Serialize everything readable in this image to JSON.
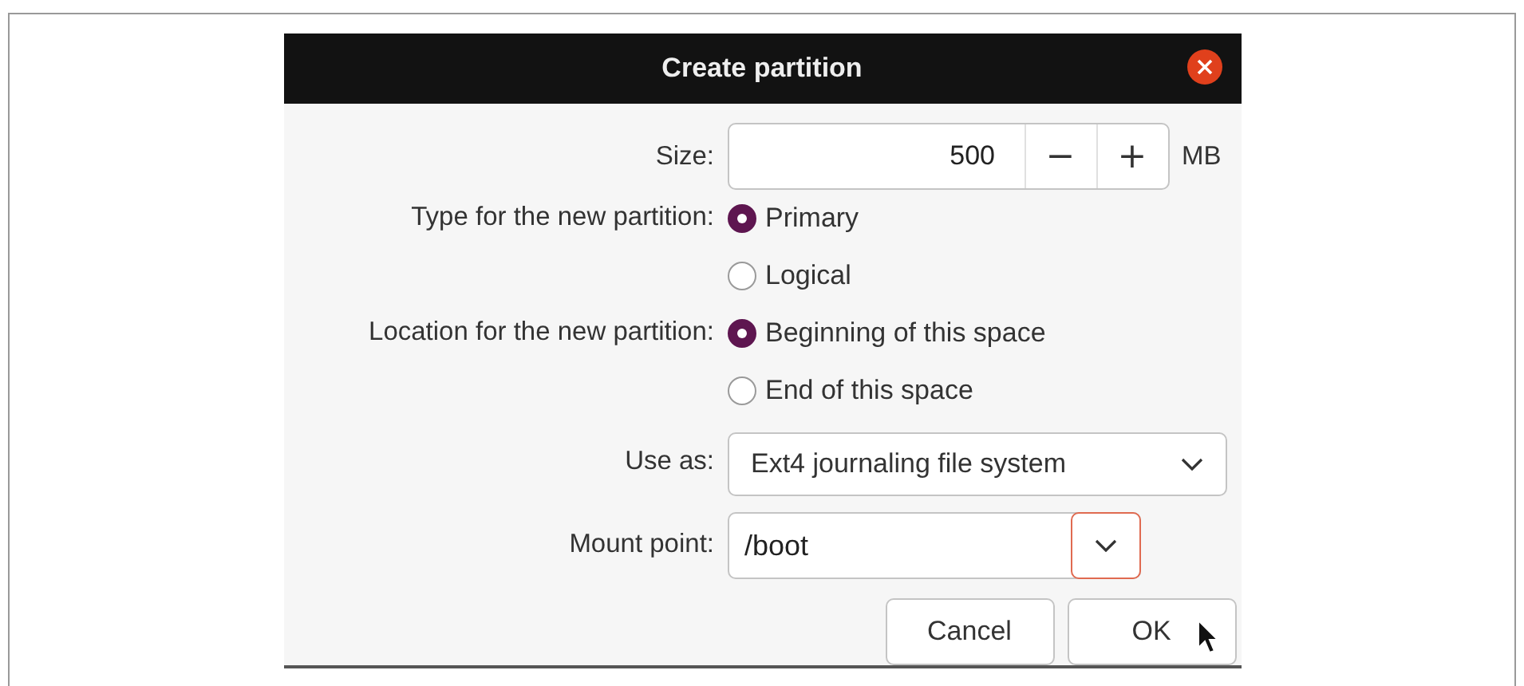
{
  "window": {
    "title": "Create partition"
  },
  "size": {
    "label": "Size:",
    "value": "500",
    "decrement": "−",
    "increment": "+",
    "unit": "MB"
  },
  "radio_groups": [
    {
      "label": "Type for the new partition:",
      "options": [
        {
          "label": "Primary",
          "selected": true
        },
        {
          "label": "Logical",
          "selected": false
        }
      ]
    },
    {
      "label": "Location for the new partition:",
      "options": [
        {
          "label": "Beginning of this space",
          "selected": true
        },
        {
          "label": "End of this space",
          "selected": false
        }
      ]
    }
  ],
  "use_as": {
    "label": "Use as:",
    "value": "Ext4 journaling file system"
  },
  "mount_point": {
    "label": "Mount point:",
    "value": "/boot"
  },
  "buttons": [
    "Cancel",
    "OK"
  ]
}
